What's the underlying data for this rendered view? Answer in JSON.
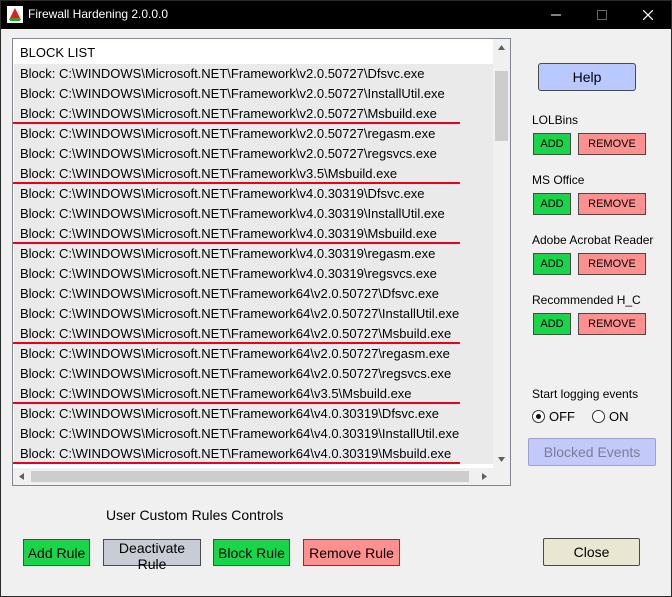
{
  "window": {
    "title": "Firewall Hardening 2.0.0.0"
  },
  "list": {
    "header": "BLOCK LIST",
    "rows": [
      {
        "text": "Block: C:\\WINDOWS\\Microsoft.NET\\Framework\\v2.0.50727\\Dfsvc.exe",
        "highlight": false
      },
      {
        "text": "Block: C:\\WINDOWS\\Microsoft.NET\\Framework\\v2.0.50727\\InstallUtil.exe",
        "highlight": false
      },
      {
        "text": "Block: C:\\WINDOWS\\Microsoft.NET\\Framework\\v2.0.50727\\Msbuild.exe",
        "highlight": true
      },
      {
        "text": "Block: C:\\WINDOWS\\Microsoft.NET\\Framework\\v2.0.50727\\regasm.exe",
        "highlight": false
      },
      {
        "text": "Block: C:\\WINDOWS\\Microsoft.NET\\Framework\\v2.0.50727\\regsvcs.exe",
        "highlight": false
      },
      {
        "text": "Block: C:\\WINDOWS\\Microsoft.NET\\Framework\\v3.5\\Msbuild.exe",
        "highlight": true
      },
      {
        "text": "Block: C:\\WINDOWS\\Microsoft.NET\\Framework\\v4.0.30319\\Dfsvc.exe",
        "highlight": false
      },
      {
        "text": "Block: C:\\WINDOWS\\Microsoft.NET\\Framework\\v4.0.30319\\InstallUtil.exe",
        "highlight": false
      },
      {
        "text": "Block: C:\\WINDOWS\\Microsoft.NET\\Framework\\v4.0.30319\\Msbuild.exe",
        "highlight": true
      },
      {
        "text": "Block: C:\\WINDOWS\\Microsoft.NET\\Framework\\v4.0.30319\\regasm.exe",
        "highlight": false
      },
      {
        "text": "Block: C:\\WINDOWS\\Microsoft.NET\\Framework\\v4.0.30319\\regsvcs.exe",
        "highlight": false
      },
      {
        "text": "Block: C:\\WINDOWS\\Microsoft.NET\\Framework64\\v2.0.50727\\Dfsvc.exe",
        "highlight": false
      },
      {
        "text": "Block: C:\\WINDOWS\\Microsoft.NET\\Framework64\\v2.0.50727\\InstallUtil.exe",
        "highlight": false
      },
      {
        "text": "Block: C:\\WINDOWS\\Microsoft.NET\\Framework64\\v2.0.50727\\Msbuild.exe",
        "highlight": true
      },
      {
        "text": "Block: C:\\WINDOWS\\Microsoft.NET\\Framework64\\v2.0.50727\\regasm.exe",
        "highlight": false
      },
      {
        "text": "Block: C:\\WINDOWS\\Microsoft.NET\\Framework64\\v2.0.50727\\regsvcs.exe",
        "highlight": false
      },
      {
        "text": "Block: C:\\WINDOWS\\Microsoft.NET\\Framework64\\v3.5\\Msbuild.exe",
        "highlight": true
      },
      {
        "text": "Block: C:\\WINDOWS\\Microsoft.NET\\Framework64\\v4.0.30319\\Dfsvc.exe",
        "highlight": false
      },
      {
        "text": "Block: C:\\WINDOWS\\Microsoft.NET\\Framework64\\v4.0.30319\\InstallUtil.exe",
        "highlight": false
      },
      {
        "text": "Block: C:\\WINDOWS\\Microsoft.NET\\Framework64\\v4.0.30319\\Msbuild.exe",
        "highlight": true
      }
    ],
    "highlight_color": "#e8001c"
  },
  "side": {
    "help_label": "Help",
    "groups": [
      {
        "label": "LOLBins",
        "add": "ADD",
        "remove": "REMOVE"
      },
      {
        "label": "MS Office",
        "add": "ADD",
        "remove": "REMOVE"
      },
      {
        "label": "Adobe Acrobat Reader",
        "add": "ADD",
        "remove": "REMOVE"
      },
      {
        "label": "Recommended H_C",
        "add": "ADD",
        "remove": "REMOVE"
      }
    ],
    "logging": {
      "label": "Start logging events",
      "off_label": "OFF",
      "on_label": "ON",
      "selected": "OFF"
    },
    "blocked_events_label": "Blocked Events"
  },
  "custom": {
    "title": "User Custom Rules Controls",
    "add_rule": "Add Rule",
    "deactivate_rule": "Deactivate Rule",
    "block_rule": "Block Rule",
    "remove_rule": "Remove Rule"
  },
  "close_label": "Close",
  "colors": {
    "add_green": "#1ad44a",
    "remove_red": "#ff9090",
    "help_blue": "#b9c9ff"
  }
}
